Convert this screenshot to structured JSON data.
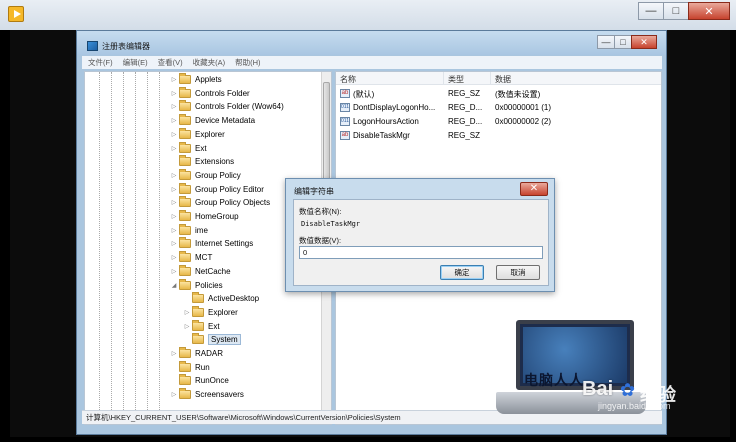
{
  "outer_window": {
    "minimize_glyph": "—",
    "maximize_glyph": "□",
    "close_glyph": "✕"
  },
  "regedit": {
    "title": "注册表编辑器",
    "menu": [
      "文件(F)",
      "编辑(E)",
      "查看(V)",
      "收藏夹(A)",
      "帮助(H)"
    ],
    "tree": [
      {
        "label": "Applets",
        "indent": 0,
        "expander": "▷"
      },
      {
        "label": "Controls Folder",
        "indent": 0,
        "expander": "▷"
      },
      {
        "label": "Controls Folder (Wow64)",
        "indent": 0,
        "expander": "▷"
      },
      {
        "label": "Device Metadata",
        "indent": 0,
        "expander": "▷"
      },
      {
        "label": "Explorer",
        "indent": 0,
        "expander": "▷"
      },
      {
        "label": "Ext",
        "indent": 0,
        "expander": "▷"
      },
      {
        "label": "Extensions",
        "indent": 0,
        "expander": ""
      },
      {
        "label": "Group Policy",
        "indent": 0,
        "expander": "▷"
      },
      {
        "label": "Group Policy Editor",
        "indent": 0,
        "expander": "▷"
      },
      {
        "label": "Group Policy Objects",
        "indent": 0,
        "expander": "▷"
      },
      {
        "label": "HomeGroup",
        "indent": 0,
        "expander": "▷"
      },
      {
        "label": "ime",
        "indent": 0,
        "expander": "▷"
      },
      {
        "label": "Internet Settings",
        "indent": 0,
        "expander": "▷"
      },
      {
        "label": "MCT",
        "indent": 0,
        "expander": "▷"
      },
      {
        "label": "NetCache",
        "indent": 0,
        "expander": "▷"
      },
      {
        "label": "Policies",
        "indent": 0,
        "expander": "◢"
      },
      {
        "label": "ActiveDesktop",
        "indent": 1,
        "expander": ""
      },
      {
        "label": "Explorer",
        "indent": 1,
        "expander": "▷"
      },
      {
        "label": "Ext",
        "indent": 1,
        "expander": "▷"
      },
      {
        "label": "System",
        "indent": 1,
        "expander": "",
        "selected": true
      },
      {
        "label": "RADAR",
        "indent": 0,
        "expander": "▷"
      },
      {
        "label": "Run",
        "indent": 0,
        "expander": ""
      },
      {
        "label": "RunOnce",
        "indent": 0,
        "expander": ""
      },
      {
        "label": "Screensavers",
        "indent": 0,
        "expander": "▷"
      }
    ],
    "columns": {
      "name": "名称",
      "type": "类型",
      "data": "数据"
    },
    "values": [
      {
        "name": "(默认)",
        "type": "REG_SZ",
        "data": "(数值未设置)",
        "icon": "ab"
      },
      {
        "name": "DontDisplayLogonHo...",
        "type": "REG_D...",
        "data": "0x00000001 (1)",
        "icon": "011"
      },
      {
        "name": "LogonHoursAction",
        "type": "REG_D...",
        "data": "0x00000002 (2)",
        "icon": "011"
      },
      {
        "name": "DisableTaskMgr",
        "type": "REG_SZ",
        "data": "",
        "icon": "ab"
      }
    ],
    "status_path": "计算机\\HKEY_CURRENT_USER\\Software\\Microsoft\\Windows\\CurrentVersion\\Policies\\System"
  },
  "dialog": {
    "title": "编辑字符串",
    "close_glyph": "✕",
    "value_name_label": "数值名称(N):",
    "value_name": "DisableTaskMgr",
    "value_data_label": "数值数据(V):",
    "value_data": "0",
    "ok_label": "确定",
    "cancel_label": "取消"
  },
  "watermark": {
    "laptop_text": "电脑人人",
    "brand": "Bai",
    "brand_suffix": "经验",
    "url": "jingyan.baidu.com"
  }
}
